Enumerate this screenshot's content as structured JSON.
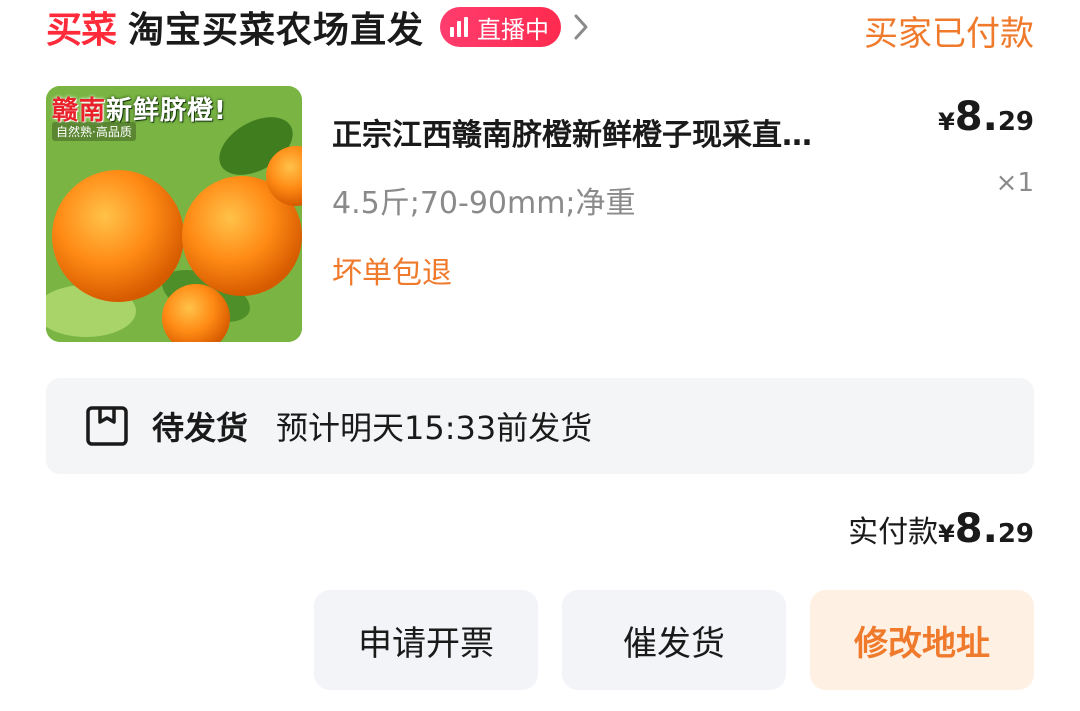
{
  "header": {
    "brand_badge": "买菜",
    "shop_name": "淘宝买菜农场直发",
    "live_badge": "直播中",
    "order_status": "买家已付款"
  },
  "product": {
    "image_banner_red": "赣南",
    "image_banner_white": "新鲜脐橙!",
    "image_subbanner": "自然熟·高品质",
    "title": "正宗江西赣南脐橙新鲜橙子现采直…",
    "spec": "4.5斤;70-90mm;净重",
    "promise": "坏单包退",
    "price": {
      "currency": "¥",
      "integer": "8.",
      "decimal": "29"
    },
    "quantity": "×1"
  },
  "shipping": {
    "state": "待发货",
    "eta": "预计明天15:33前发货"
  },
  "payment": {
    "label": "实付款",
    "currency": "¥",
    "integer": "8.",
    "decimal": "29"
  },
  "actions": {
    "invoice_label": "申请开票",
    "urge_label": "催发货",
    "edit_address_label": "修改地址"
  },
  "colors": {
    "brand_red": "#ff2b3a",
    "live_pink": "#ff3d6e",
    "accent_orange": "#f07a2c",
    "muted_gray": "#8a8a8a",
    "panel_gray": "#f4f5f7"
  },
  "icons": {
    "live": "live-bars-icon",
    "chevron": "chevron-right-icon",
    "shipping": "package-box-icon"
  }
}
